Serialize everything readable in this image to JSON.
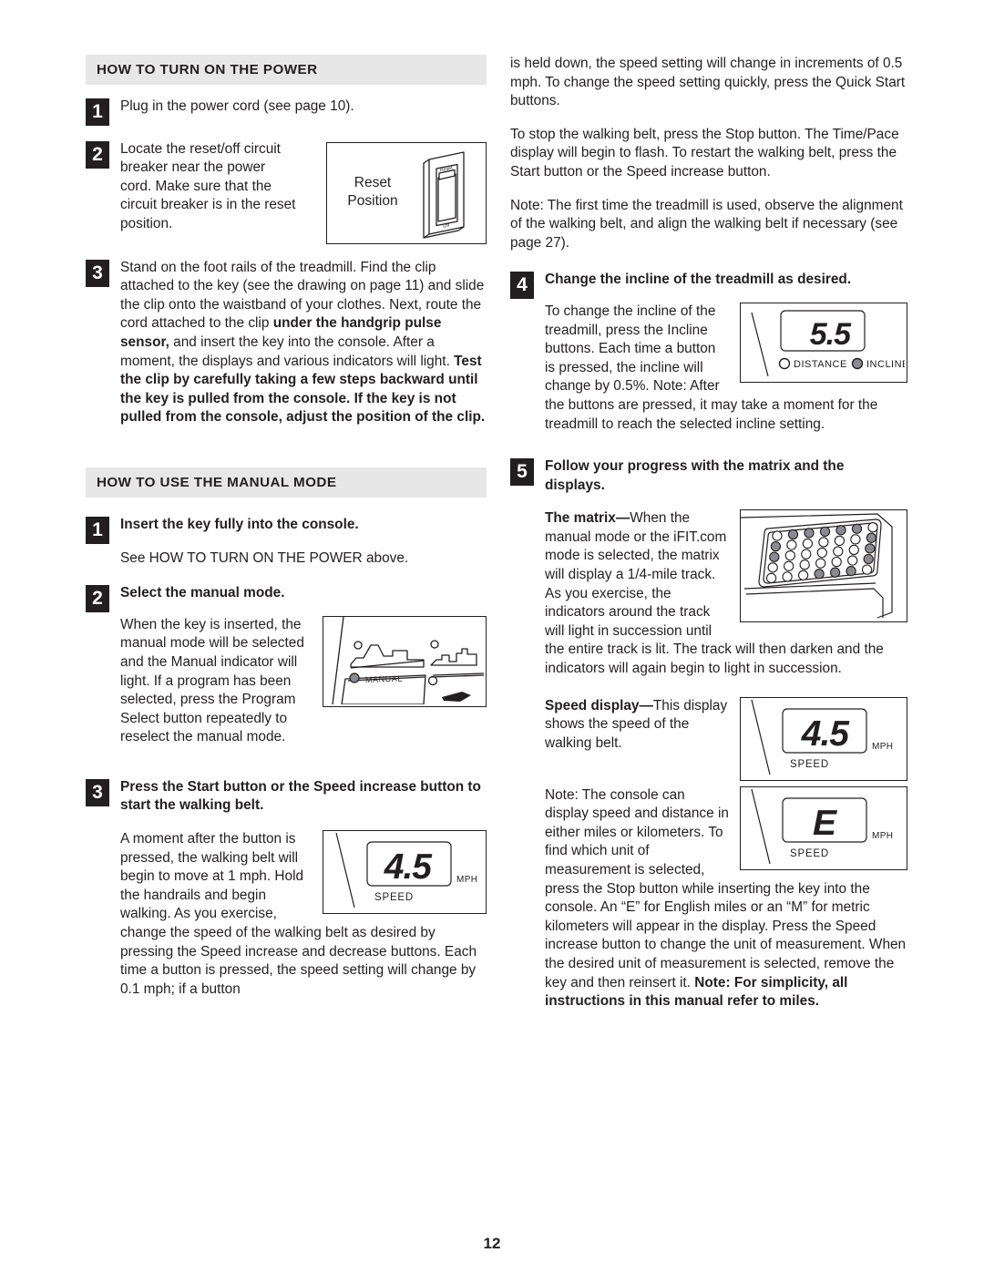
{
  "page": {
    "number": "12"
  },
  "left_column": {
    "section1": {
      "heading": "HOW TO TURN ON THE POWER",
      "steps": [
        {
          "num": "1",
          "text": "Plug in the power cord (see page 10)."
        },
        {
          "num": "2",
          "text": "Locate the reset/off circuit breaker near the power cord. Make sure that the circuit breaker is in the reset position.",
          "figure": {
            "name": "circuit-breaker-diagram",
            "label_line1": "Reset",
            "label_line2": "Position",
            "switch_top_label": "Reset",
            "switch_bottom_label": "Off"
          }
        },
        {
          "num": "3",
          "text_part1": "Stand on the foot rails of the treadmill. Find the clip attached to the key (see the drawing on page 11) and slide the clip onto the waistband of your clothes. Next, route the cord attached to the clip ",
          "bold1": "under the handgrip pulse sensor,",
          "text_part2": " and insert the key into the console. After a moment, the displays and various indicators will light. ",
          "bold2": "Test the clip by carefully taking a few steps backward until the key is pulled from the console. If the key is not pulled from the console, adjust the position of the clip."
        }
      ]
    },
    "section2": {
      "heading": "HOW TO USE THE MANUAL MODE",
      "steps": [
        {
          "num": "1",
          "title": "Insert the key fully into the console.",
          "body": "See HOW TO TURN ON THE POWER above."
        },
        {
          "num": "2",
          "title": "Select the manual mode.",
          "body": "When the key is inserted, the manual mode will be selected and the Manual indicator will light. If a program has been selected, press the Program Select button repeatedly to reselect the manual mode.",
          "figure": {
            "name": "manual-indicator-console",
            "indicator_label": "MANUAL"
          }
        },
        {
          "num": "3",
          "title": "Press the Start button or the Speed increase button to start the walking belt.",
          "body": "A moment after the button is pressed, the walking belt will begin to move at 1 mph. Hold the handrails and begin walking. As you exercise, change the speed of the walking belt as desired by pressing the Speed increase and decrease buttons. Each time a button is pressed, the speed setting will change by 0.1 mph; if a button",
          "figure": {
            "name": "speed-display",
            "value": "4.5",
            "unit": "MPH",
            "caption": "SPEED"
          }
        }
      ]
    }
  },
  "right_column": {
    "continuation": {
      "p1": "is held down, the speed setting will change in increments of 0.5 mph. To change the speed setting quickly, press the Quick Start buttons.",
      "p2": "To stop the walking belt, press the Stop button. The Time/Pace display will begin to flash. To restart the walking belt, press the Start button or the Speed increase button.",
      "p3": "Note: The first time the treadmill is used, observe the alignment of the walking belt, and align the walking belt if necessary (see page 27)."
    },
    "steps": [
      {
        "num": "4",
        "title": "Change the incline of the treadmill as desired.",
        "body": "To change the incline of the treadmill, press the Incline buttons. Each time a button is pressed, the incline will change by 0.5%. Note: After the buttons are pressed, it may take a moment for the treadmill to reach the selected incline setting.",
        "figure": {
          "name": "incline-display",
          "value": "5.5",
          "indicator_distance": "DISTANCE",
          "indicator_incline": "INCLINE",
          "active_indicator": "INCLINE"
        }
      },
      {
        "num": "5",
        "title": "Follow your progress with the matrix and the displays.",
        "subsections": [
          {
            "lead": "The matrix",
            "dash": "—",
            "body": "When the manual mode or the iFIT.com mode is selected, the matrix will display a 1/4-mile track. As you exercise, the indicators around the track will light in succession until the entire track is lit. The track will then darken and the indicators will again begin to light in succession.",
            "figure": {
              "name": "matrix-display",
              "rows": 5,
              "cols": 7,
              "lit": [
                [
                  0,
                  1,
                  1,
                  1,
                  1,
                  1,
                  0
                ],
                [
                  1,
                  0,
                  0,
                  0,
                  0,
                  0,
                  1
                ],
                [
                  1,
                  0,
                  0,
                  0,
                  0,
                  0,
                  1
                ],
                [
                  0,
                  0,
                  0,
                  0,
                  0,
                  0,
                  1
                ],
                [
                  0,
                  0,
                  0,
                  1,
                  1,
                  1,
                  0
                ]
              ]
            }
          },
          {
            "lead": "Speed display",
            "dash": "—",
            "body": "This display shows the speed of the walking belt.",
            "figure": {
              "name": "speed-display",
              "value": "4.5",
              "unit": "MPH",
              "caption": "SPEED"
            }
          }
        ],
        "note_part1": "Note: The console can display speed and distance in either miles or kilometers. To find which unit of measurement is selected, press the Stop button while inserting the key into the console. An “E” for English miles or an “M” for metric kilometers will appear in the display. Press the Speed increase button to change the unit of measurement. When the desired unit of measurement is selected, remove the key and then reinsert it. ",
        "note_bold": "Note: For simplicity, all instructions in this manual refer to miles.",
        "note_figure": {
          "name": "english-units-display",
          "value": "E",
          "unit": "MPH",
          "caption": "SPEED"
        }
      }
    ]
  },
  "colors": {
    "header_bar": "#e7e7e7",
    "ink": "#231f20",
    "step_box": "#231f20",
    "lit_dot": "#8a8a92"
  }
}
